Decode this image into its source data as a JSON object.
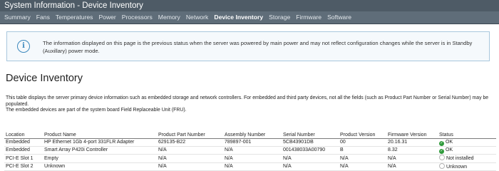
{
  "window": {
    "title": "System Information - Device Inventory"
  },
  "tabs": [
    {
      "label": "Summary",
      "active": false
    },
    {
      "label": "Fans",
      "active": false
    },
    {
      "label": "Temperatures",
      "active": false
    },
    {
      "label": "Power",
      "active": false
    },
    {
      "label": "Processors",
      "active": false
    },
    {
      "label": "Memory",
      "active": false
    },
    {
      "label": "Network",
      "active": false
    },
    {
      "label": "Device Inventory",
      "active": true
    },
    {
      "label": "Storage",
      "active": false
    },
    {
      "label": "Firmware",
      "active": false
    },
    {
      "label": "Software",
      "active": false
    }
  ],
  "notice": {
    "icon": "info-icon",
    "text": "The information displayed on this page is the previous status when the server was powered by main power and may not reflect configuration changes while the server is in Standby (Auxillary) power mode."
  },
  "page": {
    "title": "Device Inventory",
    "description": "This table displays the server primary device information such as embedded storage and network controllers. For embedded and third party devices, not all the fields (such as Product Part Number or Serial Number) may be populated.",
    "fru_note": "The embedded devices are part of the system board Field Replaceable Unit (FRU)."
  },
  "table": {
    "columns": [
      "Location",
      "Product Name",
      "Product Part Number",
      "Assembly Number",
      "Serial Number",
      "Product Version",
      "Firmware Version",
      "Status"
    ],
    "rows": [
      {
        "location": "Embedded",
        "product_name": "HP Ethernet 1Gb 4-port 331FLR Adapter",
        "part_number": "629135-B22",
        "assembly_number": "789897-001",
        "serial_number": "5CB43901DB",
        "product_version": "00",
        "firmware_version": "20.16.31",
        "status": "OK",
        "status_icon": "ok-check-icon"
      },
      {
        "location": "Embedded",
        "product_name": "Smart Array P420i Controller",
        "part_number": "N/A",
        "assembly_number": "N/A",
        "serial_number": "001438033A00790",
        "product_version": "B",
        "firmware_version": "8.32",
        "status": "OK",
        "status_icon": "ok-check-icon"
      },
      {
        "location": "PCI-E Slot 1",
        "product_name": "Empty",
        "part_number": "N/A",
        "assembly_number": "N/A",
        "serial_number": "N/A",
        "product_version": "N/A",
        "firmware_version": "N/A",
        "status": "Not installed",
        "status_icon": "empty-circle-icon"
      },
      {
        "location": "PCI-E Slot 2",
        "product_name": "Unknown",
        "part_number": "N/A",
        "assembly_number": "N/A",
        "serial_number": "N/A",
        "product_version": "N/A",
        "firmware_version": "N/A",
        "status": "Unknown",
        "status_icon": "empty-circle-icon"
      }
    ]
  },
  "colors": {
    "title_bar": "#4e5b66",
    "tab_bar": "#5f6d79",
    "notice_border": "#a9c7dd",
    "status_ok": "#2f9a3b"
  }
}
